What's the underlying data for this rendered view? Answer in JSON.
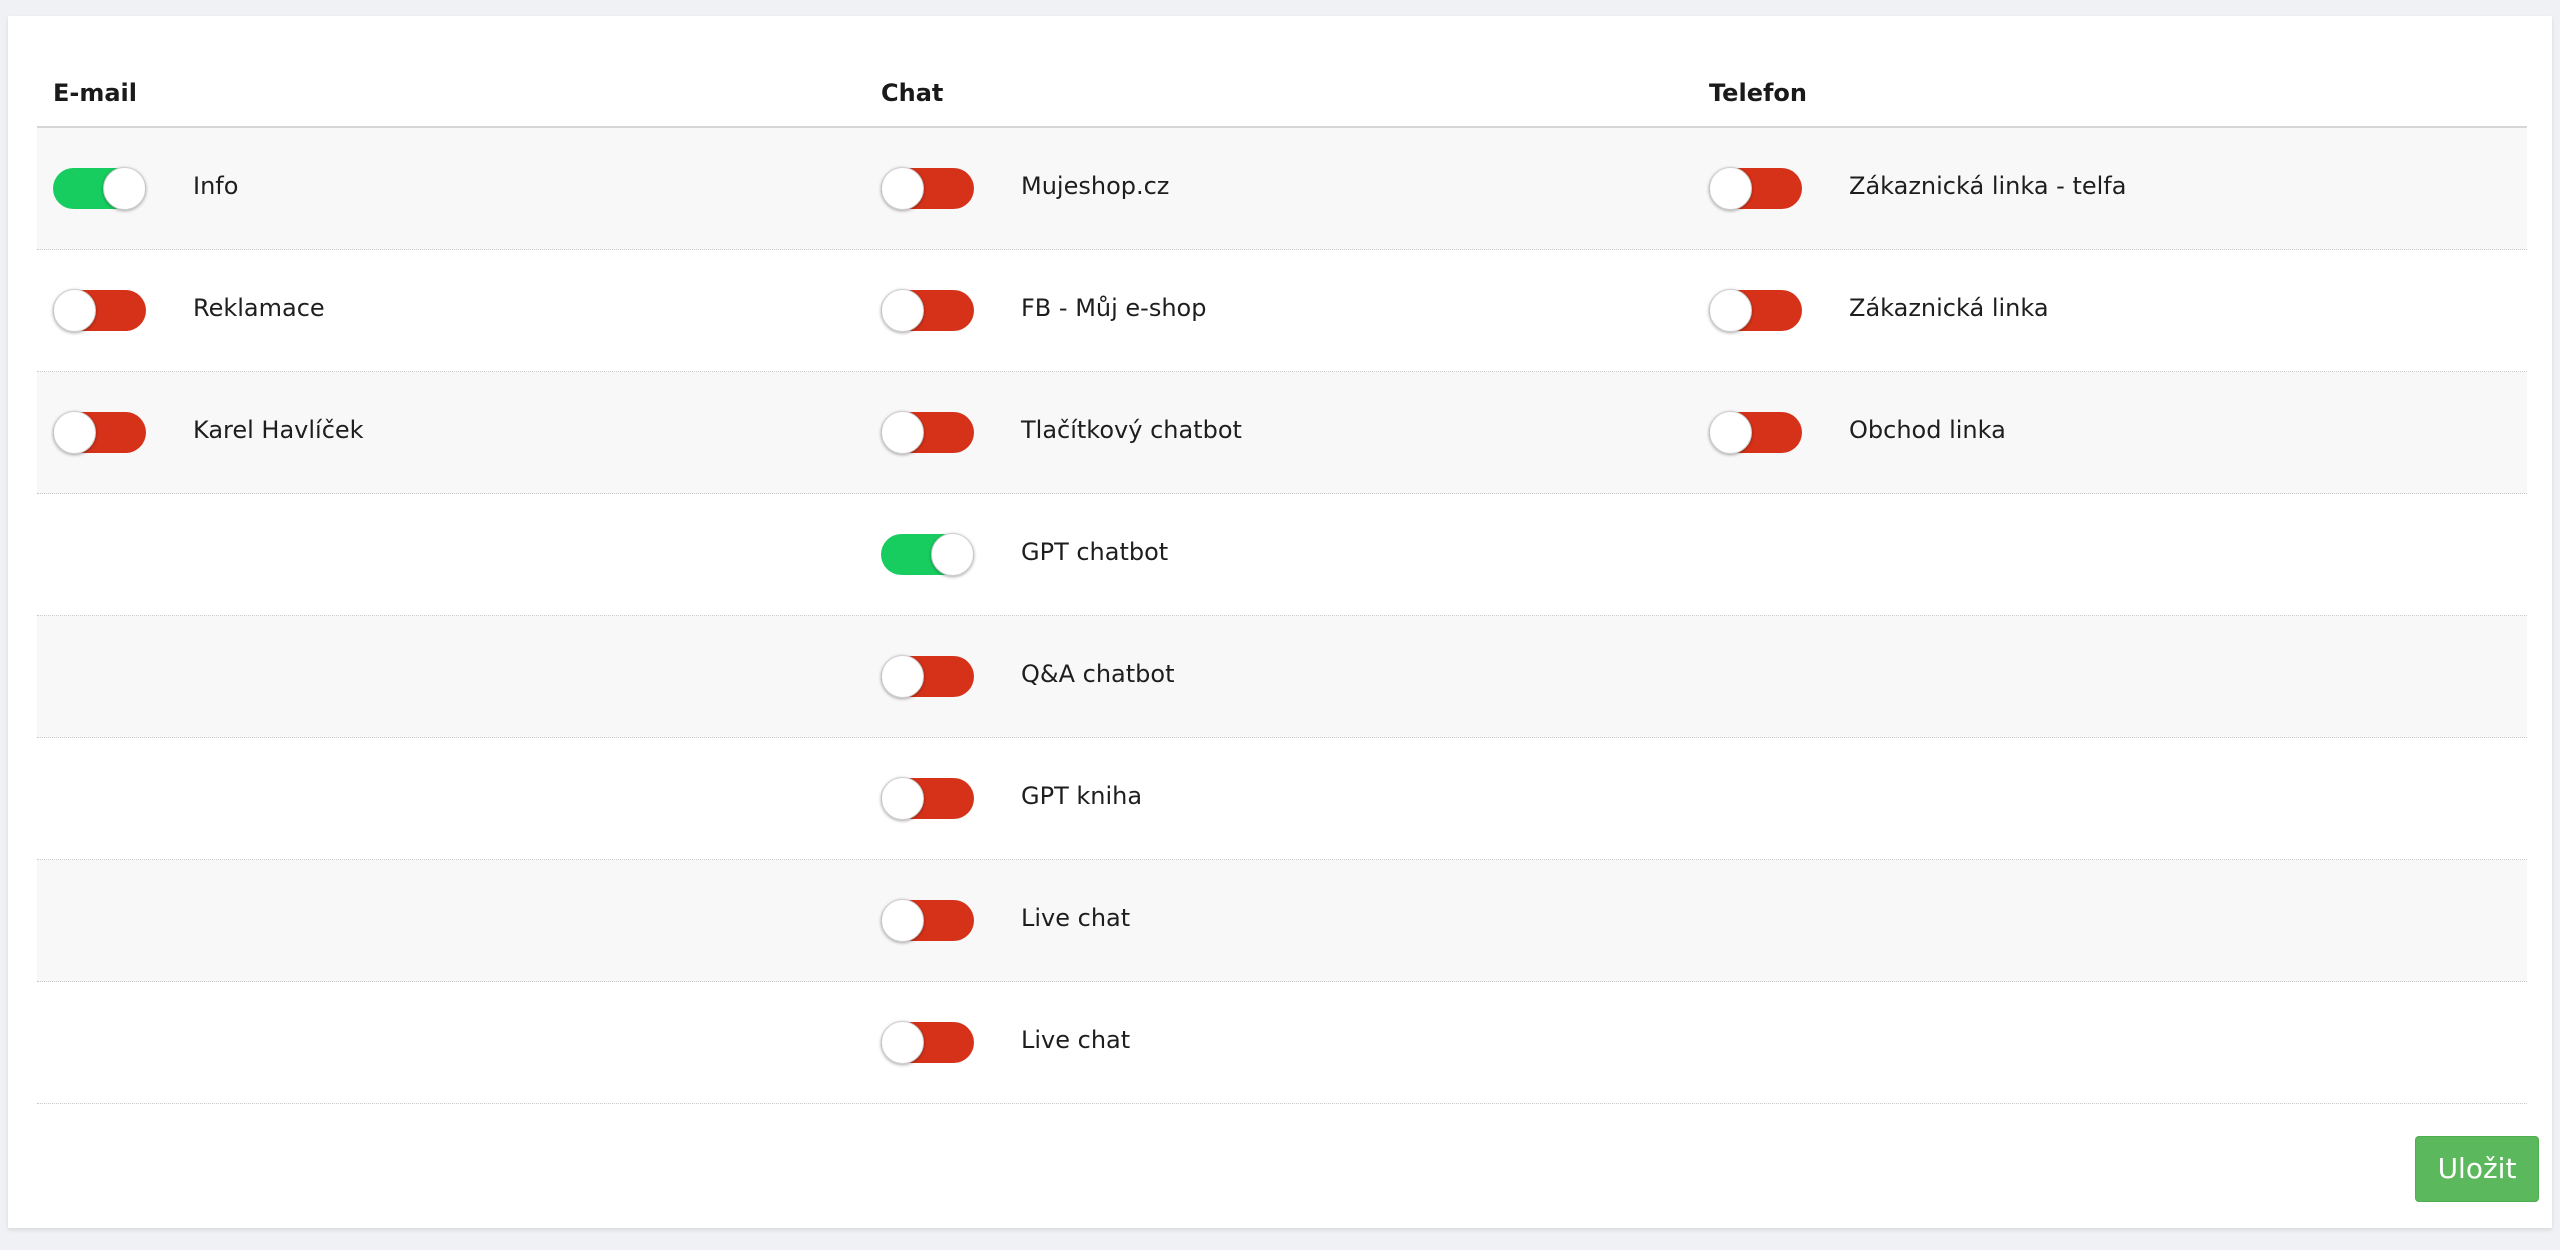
{
  "columns": [
    "E-mail",
    "Chat",
    "Telefon"
  ],
  "colors": {
    "toggle_on": "#18cd60",
    "toggle_off": "#d63219",
    "save_button": "#5cb85c"
  },
  "email": [
    {
      "label": "Info",
      "enabled": true
    },
    {
      "label": "Reklamace",
      "enabled": false
    },
    {
      "label": "Karel Havlíček",
      "enabled": false
    }
  ],
  "chat": [
    {
      "label": "Mujeshop.cz",
      "enabled": false
    },
    {
      "label": "FB - Můj e-shop",
      "enabled": false
    },
    {
      "label": "Tlačítkový chatbot",
      "enabled": false
    },
    {
      "label": "GPT chatbot",
      "enabled": true
    },
    {
      "label": "Q&A chatbot",
      "enabled": false
    },
    {
      "label": "GPT kniha",
      "enabled": false
    },
    {
      "label": "Live chat",
      "enabled": false
    },
    {
      "label": "Live chat",
      "enabled": false
    }
  ],
  "phone": [
    {
      "label": "Zákaznická linka - telfa",
      "enabled": false
    },
    {
      "label": "Zákaznická linka",
      "enabled": false
    },
    {
      "label": "Obchod linka",
      "enabled": false
    }
  ],
  "save_label": "Uložit"
}
